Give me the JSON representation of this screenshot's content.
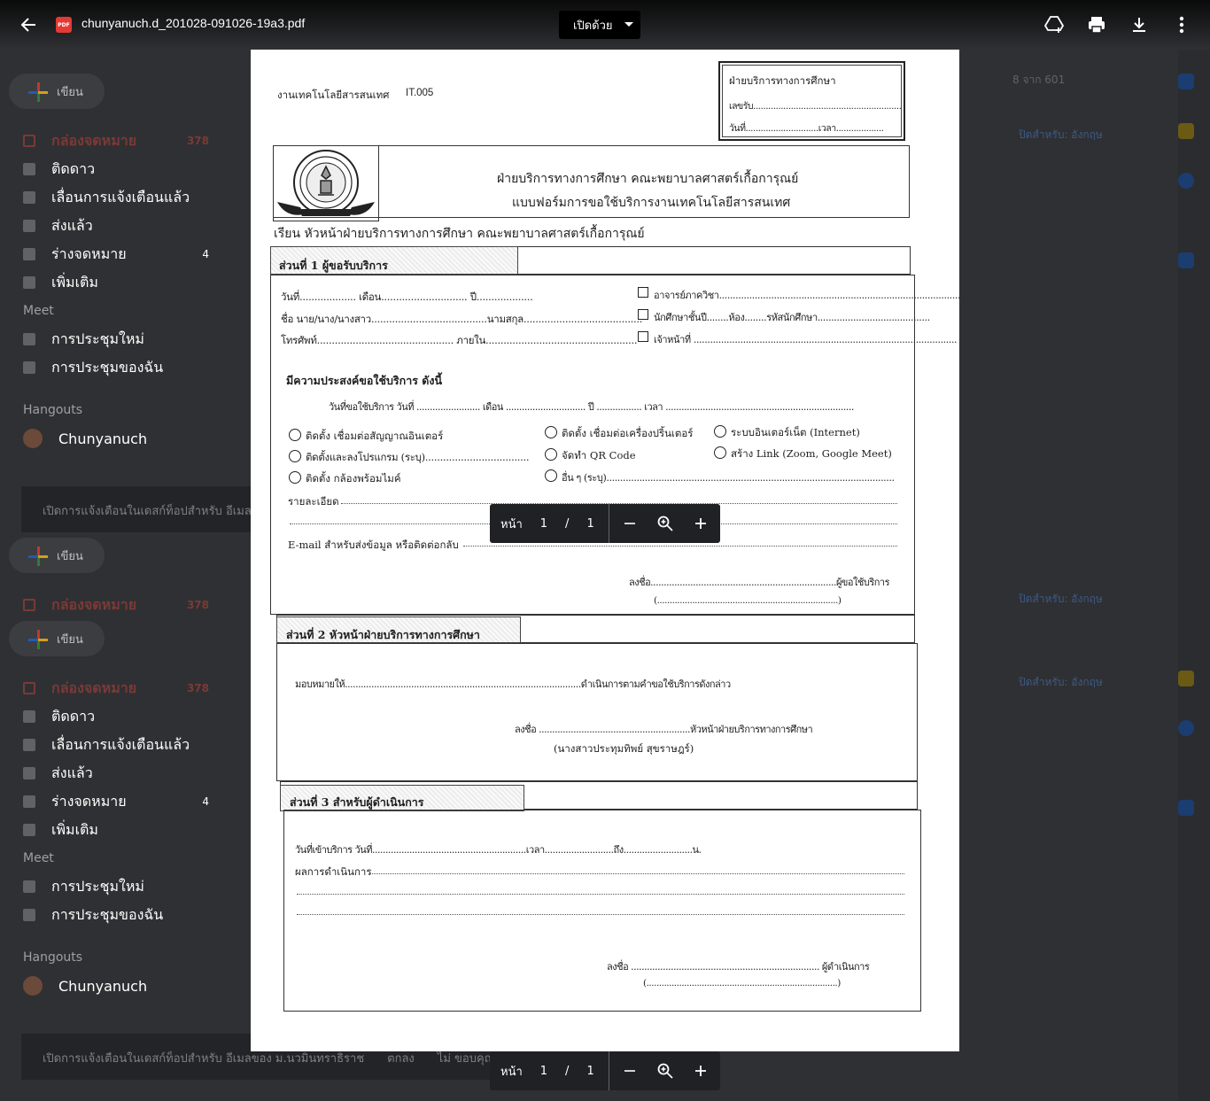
{
  "viewer": {
    "file_name": "chunyanuch.d_201028-091026-19a3.pdf",
    "file_badge": "PDF",
    "open_with_label": "เปิดด้วย"
  },
  "pager": {
    "page_label": "หน้า",
    "current_page": "1",
    "separator": "/",
    "total_pages": "1"
  },
  "background": {
    "compose_label": "เขียน",
    "inbox_label": "กล่องจดหมาย",
    "inbox_count": "378",
    "starred_label": "ติดดาว",
    "snoozed_label": "เลื่อนการแจ้งเตือนแล้ว",
    "sent_label": "ส่งแล้ว",
    "drafts_label": "ร่างจดหมาย",
    "drafts_count": "4",
    "more_label": "เพิ่มเติม",
    "meet_heading": "Meet",
    "new_meeting_label": "การประชุมใหม่",
    "my_meetings_label": "การประชุมของฉัน",
    "hangouts_heading": "Hangouts",
    "user_name": "Chunyanuch",
    "toast_text": "เปิดการแจ้งเตือนในเดสก์ท็อปสำหรับ อีเมลของ ม.นวมินทราธิราช",
    "toast_action_1": "ตกลง",
    "toast_action_2": "ไม่ ขอบคุณ",
    "count_text": "8 จาก 601",
    "tag_text": "ปิดสำหรับ: อังกฤษ"
  },
  "form": {
    "header_left": "งานเทคโนโลยีสารสนเทศ",
    "form_code": "IT.005",
    "receipt_box_title": "ฝ่ายบริการทางการศึกษา",
    "receipt_no": "เลขรับ...........................................................",
    "receipt_date": "วันที่.............................เวลา...................",
    "title_line1": "ฝ่ายบริการทางการศึกษา คณะพยาบาลศาสตร์เกื้อการุณย์",
    "title_line2": "แบบฟอร์มการขอใช้บริการงานเทคโนโลยีสารสนเทศ",
    "salutation": "เรียน หัวหน้าฝ่ายบริการทางการศึกษา คณะพยาบาลศาสตร์เกื้อการุณย์",
    "section1_title": "ส่วนที่ 1 ผู้ขอรับบริการ",
    "s1_date": "วันที่................... เดือน............................. ปี...................",
    "s1_name": "ชื่อ นาย/นาง/นางสาว.......................................นามสกุล........................................",
    "s1_phone": "โทรศัพท์.............................................. ภายใน...................................................",
    "opt_teacher": "อาจารย์ภาควิชา.........................................................................................",
    "opt_student": "นักศึกษาชั้นปี........ห้อง........รหัสนักศึกษา.........................................",
    "opt_staff": "เจ้าหน้าที่ ................................................................................................",
    "purpose_heading": "มีความประสงค์ขอใช้บริการ ดังนี้",
    "service_date": "วันที่ขอใช้บริการ   วันที่ ........................ เดือน .............................. ปี ................. เวลา .......................................................................",
    "svc_1": "ติดตั้ง เชื่อมต่อสัญญาณอินเตอร์",
    "svc_2": "ติดตั้ง เชื่อมต่อเครื่องปริ้นเตอร์",
    "svc_3": "ระบบอินเตอร์เน็ต (Internet)",
    "svc_4": "ติดตั้งและลงโปรแกรม (ระบุ)...................................",
    "svc_5": "จัดทำ QR Code",
    "svc_6": "สร้าง Link (Zoom, Google Meet)",
    "svc_7": "ติดตั้ง กล้องพร้อมไมค์",
    "svc_8": "อื่น ๆ (ระบุ).........................................................................................................",
    "details_label": "รายละเอียด",
    "email_label": "E-mail สำหรับส่งข้อมูล หรือติดต่อกลับ",
    "s1_sign": "ลงชื่อ......................................................................ผู้ขอใช้บริการ",
    "s1_sign_paren": "(........................................................................)",
    "section2_title": "ส่วนที่ 2 หัวหน้าฝ่ายบริการทางการศึกษา",
    "s2_assign": "มอบหมายให้.........................................................................................ดำเนินการตามคำขอใช้บริการดังกล่าว",
    "s2_sign": "ลงชื่อ .........................................................หัวหน้าฝ่ายบริการทางการศึกษา",
    "s2_name": "(นางสาวประทุมทิพย์  สุขราษฎร์)",
    "section3_title": "ส่วนที่ 3 สำหรับผู้ดำเนินการ",
    "s3_date": "วันที่เข้าบริการ วันที่..........................................................เวลา..........................ถึง..........................น.",
    "s3_result": "ผลการดำเนินการ",
    "s3_sign": "ลงชื่อ ....................................................................... ผู้ดำเนินการ",
    "s3_sign_paren": "(............................................................................)"
  }
}
